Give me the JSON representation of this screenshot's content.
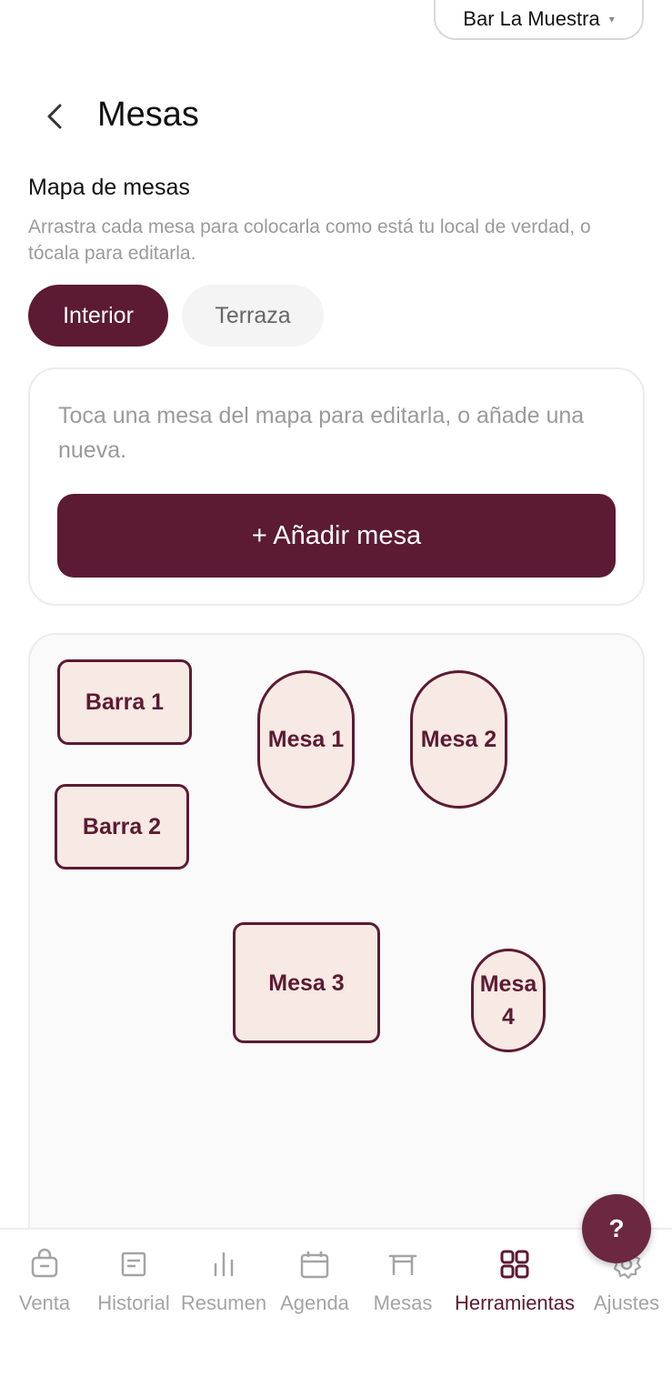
{
  "header": {
    "venue": "Bar La Muestra",
    "venue_caret": "▾",
    "title": "Mesas"
  },
  "map_section": {
    "title": "Mapa de mesas",
    "description": "Arrastra cada mesa para colocarla como está tu local de verdad, o tócala para editarla."
  },
  "tabs": [
    {
      "label": "Interior",
      "selected": true
    },
    {
      "label": "Terraza",
      "selected": false
    }
  ],
  "edit_card": {
    "hint": "Toca una mesa del mapa para editarla, o añade una nueva.",
    "add_button": "+ Añadir mesa"
  },
  "tables": [
    {
      "name": "Barra 1",
      "shape": "rectangle"
    },
    {
      "name": "Barra 2",
      "shape": "rectangle"
    },
    {
      "name": "Mesa 1",
      "shape": "pill"
    },
    {
      "name": "Mesa 2",
      "shape": "pill"
    },
    {
      "name": "Mesa 3",
      "shape": "square"
    },
    {
      "name": "Mesa 4",
      "shape": "pill"
    }
  ],
  "help_button": "?",
  "nav": [
    {
      "label": "Venta",
      "icon": "bag-icon",
      "active": false
    },
    {
      "label": "Historial",
      "icon": "receipt-icon",
      "active": false
    },
    {
      "label": "Resumen",
      "icon": "bar-chart-icon",
      "active": false
    },
    {
      "label": "Agenda",
      "icon": "calendar-icon",
      "active": false
    },
    {
      "label": "Mesas",
      "icon": "table-icon",
      "active": false
    },
    {
      "label": "Herramientas",
      "icon": "grid-icon",
      "active": true
    },
    {
      "label": "Ajustes",
      "icon": "gear-icon",
      "active": false
    }
  ],
  "colors": {
    "brand": "#5c1a33",
    "table_fill": "#f7e9e3",
    "muted_text": "#9a9a9a"
  }
}
